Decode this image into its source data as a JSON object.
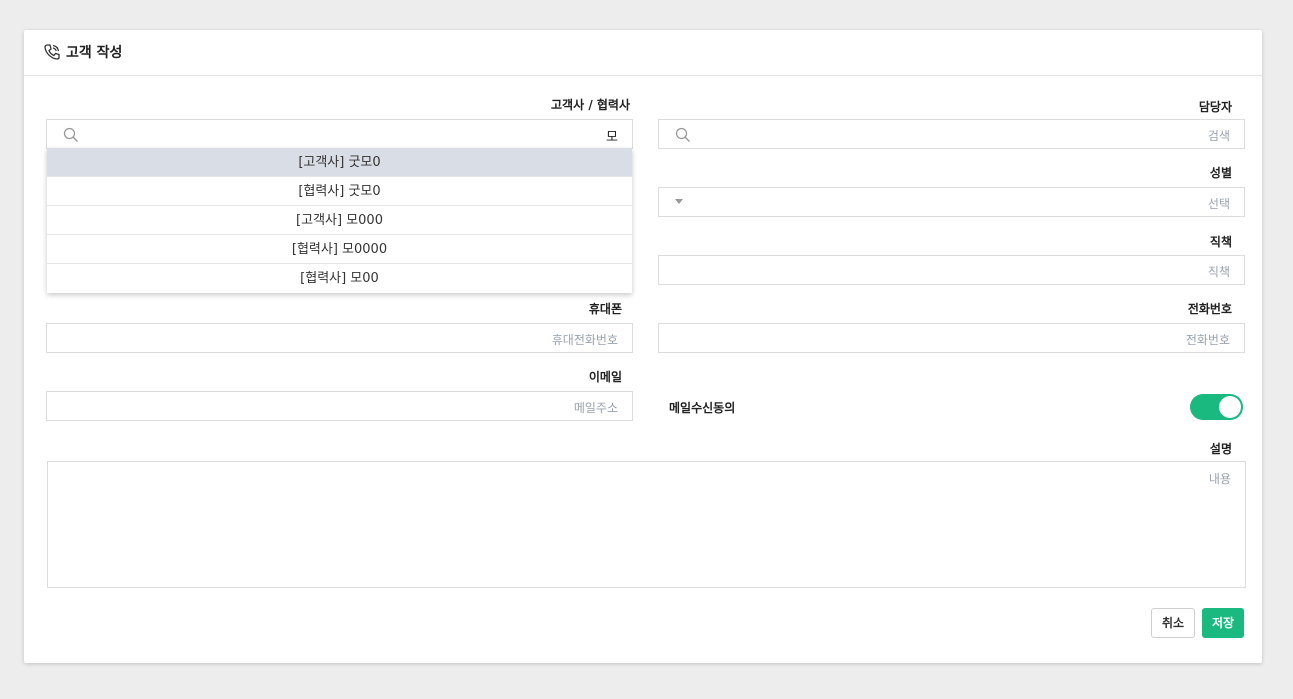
{
  "header": {
    "title": "고객 작성",
    "icon": "phone-icon"
  },
  "form": {
    "company": {
      "label": "고객사 / 협력사",
      "value": "모",
      "icon": "search-icon"
    },
    "manager": {
      "label": "담당자",
      "placeholder": "검색",
      "icon": "search-icon"
    },
    "gender": {
      "label": "성별",
      "placeholder": "선택",
      "icon": "caret-down-icon"
    },
    "position": {
      "label": "직책",
      "placeholder": "직책"
    },
    "mobile": {
      "label": "휴대폰",
      "placeholder": "휴대전화번호"
    },
    "phone": {
      "label": "전화번호",
      "placeholder": "전화번호"
    },
    "email": {
      "label": "이메일",
      "placeholder": "메일주소"
    },
    "email_consent": {
      "label": "메일수신동의",
      "enabled": true
    },
    "description": {
      "label": "설명",
      "placeholder": "내용"
    }
  },
  "dropdown": {
    "items": [
      {
        "label": "[고객사] 굿모0",
        "active": true
      },
      {
        "label": "[협력사] 굿모0",
        "active": false
      },
      {
        "label": "[고객사] 모000",
        "active": false
      },
      {
        "label": "[협력사] 모0000",
        "active": false
      },
      {
        "label": "[협력사] 모00",
        "active": false
      }
    ]
  },
  "actions": {
    "cancel_label": "취소",
    "save_label": "저장"
  },
  "colors": {
    "accent": "#19b980",
    "dropdown_active": "#d9dde5",
    "background": "#ededed"
  }
}
